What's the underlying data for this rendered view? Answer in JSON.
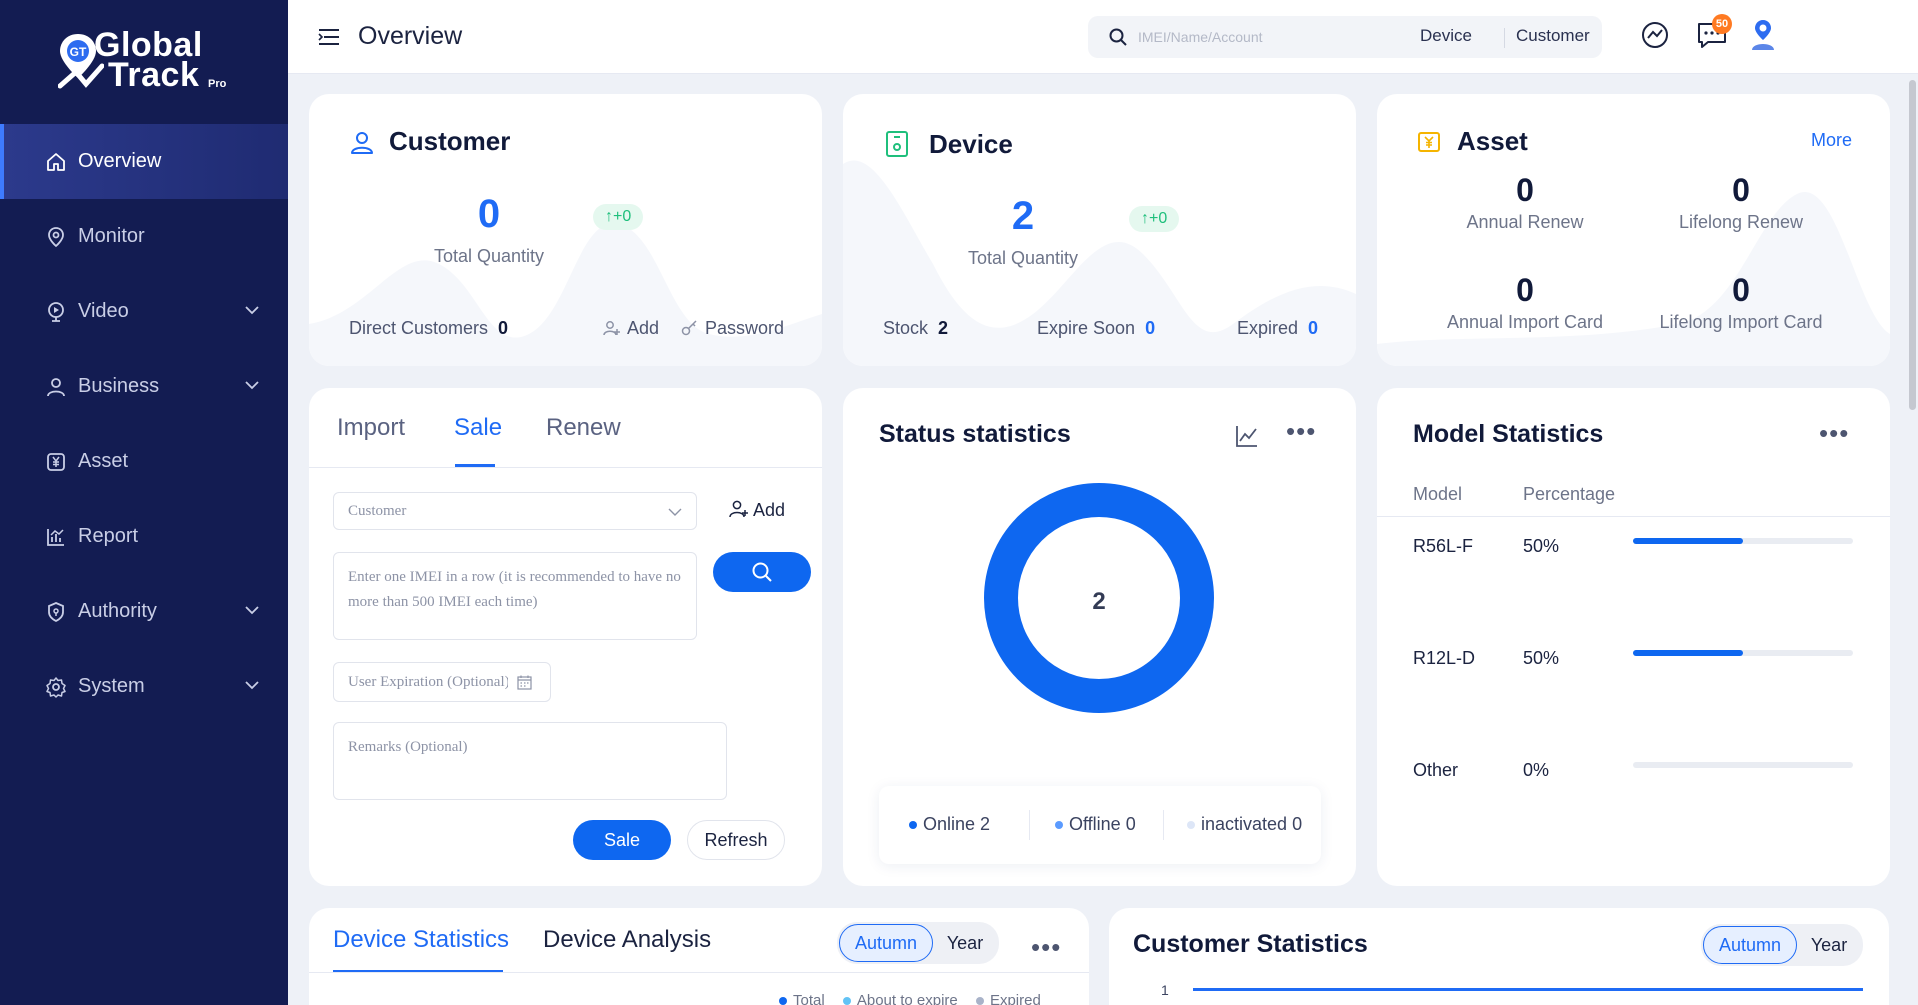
{
  "sidebar": {
    "logo_line1": "Global",
    "logo_line2": "Track",
    "logo_pro": "Pro",
    "items": [
      {
        "label": "Overview",
        "icon": "home-icon"
      },
      {
        "label": "Monitor",
        "icon": "location-pin-icon"
      },
      {
        "label": "Video",
        "icon": "video-pin-icon"
      },
      {
        "label": "Business",
        "icon": "user-icon"
      },
      {
        "label": "Asset",
        "icon": "yen-icon"
      },
      {
        "label": "Report",
        "icon": "chart-icon"
      },
      {
        "label": "Authority",
        "icon": "shield-icon"
      },
      {
        "label": "System",
        "icon": "gear-icon"
      }
    ]
  },
  "header": {
    "title": "Overview",
    "search_placeholder": "IMEI/Name/Account",
    "search_tab_device": "Device",
    "search_tab_customer": "Customer",
    "message_badge": "50"
  },
  "customer": {
    "title": "Customer",
    "total": "0",
    "delta": "↑+0",
    "total_label": "Total Quantity",
    "direct_label": "Direct Customers",
    "direct_value": "0",
    "add_label": "Add",
    "password_label": "Password"
  },
  "device": {
    "title": "Device",
    "total": "2",
    "delta": "↑+0",
    "total_label": "Total Quantity",
    "stock_label": "Stock",
    "stock_value": "2",
    "expire_label": "Expire Soon",
    "expire_value": "0",
    "expired_label": "Expired",
    "expired_value": "0"
  },
  "asset": {
    "title": "Asset",
    "more": "More",
    "annual_renew": "0",
    "annual_renew_label": "Annual Renew",
    "lifelong_renew": "0",
    "lifelong_renew_label": "Lifelong Renew",
    "annual_import": "0",
    "annual_import_label": "Annual Import Card",
    "lifelong_import": "0",
    "lifelong_import_label": "Lifelong Import Card"
  },
  "sale": {
    "tabs": [
      "Import",
      "Sale",
      "Renew"
    ],
    "customer_placeholder": "Customer",
    "add_label": "Add",
    "imei_placeholder": "Enter one IMEI in a row (it is recommended to have no more than 500 IMEI each time)",
    "expiration_placeholder": "User Expiration (Optional)",
    "remarks_placeholder": "Remarks (Optional)",
    "sale_button": "Sale",
    "refresh_button": "Refresh"
  },
  "status": {
    "title": "Status statistics",
    "center": "2",
    "online_label": "Online",
    "online_value": "2",
    "offline_label": "Offline",
    "offline_value": "0",
    "inactivated_label": "inactivated",
    "inactivated_value": "0",
    "colors": {
      "online": "#0e67f0",
      "offline": "#5b9bff",
      "inactivated": "#dde6f7"
    }
  },
  "model": {
    "title": "Model Statistics",
    "col_model": "Model",
    "col_percentage": "Percentage",
    "rows": [
      {
        "name": "R56L-F",
        "pct": "50%",
        "value": 50
      },
      {
        "name": "R12L-D",
        "pct": "50%",
        "value": 50
      },
      {
        "name": "Other",
        "pct": "0%",
        "value": 0
      }
    ]
  },
  "device_stats": {
    "tab1": "Device Statistics",
    "tab2": "Device Analysis",
    "seg1": "Autumn",
    "seg2": "Year",
    "legend_total": "Total",
    "legend_about": "About to expire",
    "legend_expired": "Expired"
  },
  "customer_stats": {
    "title": "Customer Statistics",
    "seg1": "Autumn",
    "seg2": "Year",
    "y_tick": "1"
  }
}
